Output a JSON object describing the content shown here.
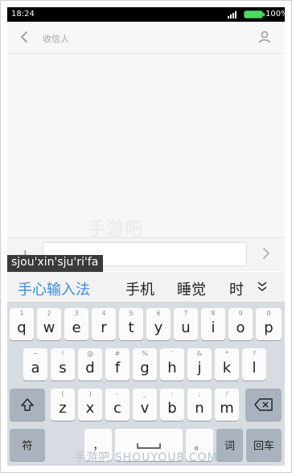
{
  "status_bar": {
    "time": "18:24",
    "battery": "100%",
    "signal_icon": "signal-icon",
    "battery_icon": "battery-icon"
  },
  "header": {
    "recipient_placeholder": "收信人",
    "back_icon": "chevron-left-icon",
    "contact_icon": "person-icon"
  },
  "message_area": {
    "watermark": "手游吧"
  },
  "compose": {
    "add_icon": "plus-icon",
    "send_icon": "send-icon"
  },
  "ime": {
    "pinyin": "sjou'xin'sju'ri'fa",
    "candidates": [
      "手心输入法",
      "手机",
      "睡觉",
      "时"
    ],
    "expand_icon": "chevron-down-icon"
  },
  "keyboard": {
    "row1": [
      {
        "sub": "1",
        "key": "q"
      },
      {
        "sub": "2",
        "key": "w"
      },
      {
        "sub": "3",
        "key": "e"
      },
      {
        "sub": "4",
        "key": "r"
      },
      {
        "sub": "5",
        "key": "t"
      },
      {
        "sub": "6",
        "key": "y"
      },
      {
        "sub": "7",
        "key": "u"
      },
      {
        "sub": "8",
        "key": "i"
      },
      {
        "sub": "9",
        "key": "o"
      },
      {
        "sub": "0",
        "key": "p"
      }
    ],
    "row2": [
      {
        "sub": "~",
        "key": "a"
      },
      {
        "sub": "!",
        "key": "s"
      },
      {
        "sub": "@",
        "key": "d"
      },
      {
        "sub": "#",
        "key": "f"
      },
      {
        "sub": "%",
        "key": "g"
      },
      {
        "sub": "'",
        "key": "h"
      },
      {
        "sub": "&",
        "key": "j"
      },
      {
        "sub": "*",
        "key": "k"
      },
      {
        "sub": "?",
        "key": "l"
      }
    ],
    "row3": [
      {
        "sub": "(",
        "key": "z"
      },
      {
        "sub": ")",
        "key": "x"
      },
      {
        "sub": "-",
        "key": "c"
      },
      {
        "sub": "_",
        "key": "v"
      },
      {
        "sub": ":",
        "key": "b"
      },
      {
        "sub": ";",
        "key": "n"
      },
      {
        "sub": "/",
        "key": "m"
      }
    ],
    "shift_icon": "shift-icon",
    "delete_icon": "backspace-icon",
    "symbols_label": "符",
    "comma_label": "，",
    "space_icon": "space-icon",
    "period_label": "。",
    "word_label": "词",
    "enter_label": "回车"
  },
  "footer": {
    "watermark": "手游吧 SHOUYOU8.COM"
  }
}
